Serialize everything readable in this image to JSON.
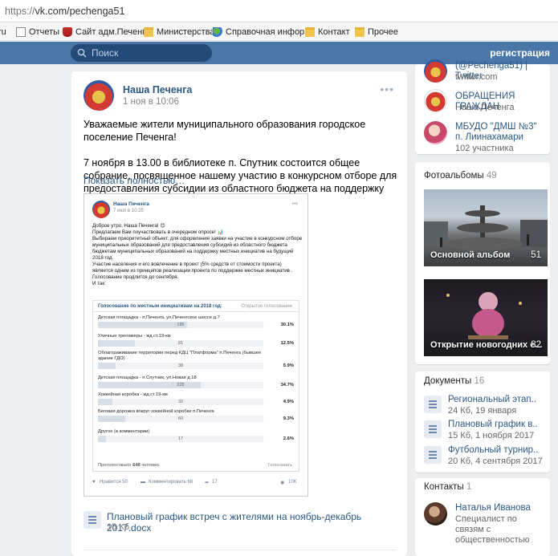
{
  "browser": {
    "url_prefix": "https://",
    "url_host": "vk.com/pechenga51",
    "bookmarks": [
      {
        "label": "ru",
        "icon": "none"
      },
      {
        "label": "Отчеты",
        "icon": "page-icon"
      },
      {
        "label": "Сайт адм.Печенга",
        "icon": "coat-of-arms-icon"
      },
      {
        "label": "Министерства",
        "icon": "folder-icon"
      },
      {
        "label": "Справочная инфор",
        "icon": "site-icon"
      },
      {
        "label": "Контакт",
        "icon": "folder-icon"
      },
      {
        "label": "Прочее",
        "icon": "folder-icon"
      }
    ]
  },
  "header": {
    "search_placeholder": "Поиск",
    "register_label": "регистрация",
    "brand_color": "#4a76a8"
  },
  "post": {
    "author": "Наша Печенга",
    "date": "1 ноя в 10:06",
    "menu": "•••",
    "text": [
      "Уважаемые жители муниципального образования городское поселение Печенга!",
      "7 ноября в 13.00 в библиотеке п. Спутник состоится общее собрание, посвященное нашему участию в конкурсном отборе для предоставления субсидии из областного бюджета на поддержку местных инициатив!"
    ],
    "show_more": "Показать полностью…",
    "attachment": {
      "name": "Плановый график встреч с жителями на ноябрь-декабрь 2017.docx",
      "size": "15 Кб"
    }
  },
  "repost": {
    "author": "Наша Печенга",
    "date": "7 июл в 10:25",
    "text": [
      "Доброе утро, Наша Печенга! 😊",
      "Предлагаем Вам поучаствовать в очередном опросе! 📊",
      "Выбираем приоритетный объект, для оформления заявки на участие в конкурсном отборе муниципальных образований для предоставления субсидий из областного бюджета бюджетам муниципальных образований на поддержку местных инициатив на будущий 2018 год.",
      "Участие населения и его вовлечение в проект (5% средств от стоимости проекта) является одним из принципов реализации проекта по поддержке местных инициатив . Голосование продлится до сентября.",
      "И так:"
    ],
    "poll": {
      "title": "Голосование по местным инициативам на 2018 год:",
      "type": "Открытое голосование",
      "options": [
        {
          "label": "Детская площадка - п.Печенга, ул.Печенгское шоссе д.7",
          "count": "195",
          "percent": "30.1%",
          "share": 0.301
        },
        {
          "label": "Уличные тренажеры - жд.ст.19-км",
          "count": "81",
          "percent": "12.5%",
          "share": 0.125
        },
        {
          "label": "Облагораживание территории перед КДЦ \"Платформа\" п.Печенга (бывшее здание ГДО)",
          "count": "38",
          "percent": "5.9%",
          "share": 0.059
        },
        {
          "label": "Детская площадка - п.Спутник, ул.Новая д.18",
          "count": "225",
          "percent": "34.7%",
          "share": 0.347
        },
        {
          "label": "Хоккейная коробка - жд.ст.19-км",
          "count": "32",
          "percent": "4.9%",
          "share": 0.049
        },
        {
          "label": "Беговая дорожка вокруг хоккейной коробки п.Печенга",
          "count": "60",
          "percent": "9.3%",
          "share": 0.093
        },
        {
          "label": "Другое (в комментарии)",
          "count": "17",
          "percent": "2.6%",
          "share": 0.026
        }
      ],
      "voted_prefix": "Проголосовало ",
      "voted_count": "648",
      "voted_suffix": " человек.",
      "vote_link": "Голосовать"
    },
    "actions": {
      "like": "Нравится 50",
      "comment": "Комментировать 68",
      "share": "17",
      "views": "10K"
    }
  },
  "sidebar": {
    "links": [
      {
        "title": "(@Pechenga51) | Twitter",
        "sub": "twitter.com"
      },
      {
        "title": "ОБРАЩЕНИЯ ГРАЖДАН",
        "sub": "Наша Печенга"
      },
      {
        "title": "МБУДО \"ДМШ №3\" п. Лиинахамари",
        "sub": "102 участника"
      }
    ],
    "albums": {
      "title": "Фотоальбомы",
      "count": "49",
      "items": [
        {
          "caption": "Основной альбом",
          "count": "51"
        },
        {
          "caption": "Открытие новогодних е...",
          "count": "82"
        }
      ]
    },
    "documents": {
      "title": "Документы",
      "count": "16",
      "items": [
        {
          "name": "Региональный этап..",
          "sub": "24 Кб, 19 января"
        },
        {
          "name": "Плановый график в..",
          "sub": "15 Кб, 1 ноября 2017"
        },
        {
          "name": "Футбольный турнир..",
          "sub": "20 Кб, 4 сентября 2017"
        }
      ]
    },
    "contacts": {
      "title": "Контакты",
      "count": "1",
      "items": [
        {
          "name": "Наталья Иванова",
          "role": "Специалист по связям с общественностью"
        }
      ]
    }
  }
}
